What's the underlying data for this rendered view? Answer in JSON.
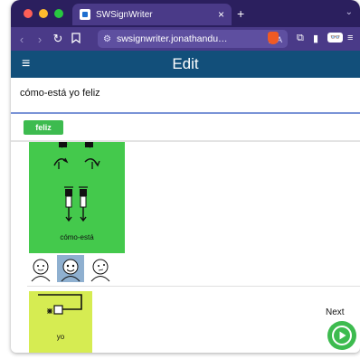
{
  "browser": {
    "traffic_lights": [
      "#fe5f57",
      "#febc2e",
      "#28c840"
    ],
    "tab_title": "SWSignWriter",
    "tab_close": "×",
    "new_tab": "+",
    "tab_menu": "⌄",
    "url": "swsignwriter.jonathandu…",
    "icons": [
      "back-arrow-icon",
      "forward-arrow-icon",
      "reload-icon",
      "bookmark-icon",
      "site-settings-icon",
      "translate-icon",
      "brave-shield-icon",
      "extensions-icon",
      "sidebar-icon",
      "private-glasses-icon",
      "menu-icon"
    ]
  },
  "app": {
    "title": "Edit",
    "header_color": "#124f7a",
    "sign_text": "cómo-está yo feliz",
    "chip": "feliz",
    "chip_color": "#3dbb4f"
  },
  "signs": [
    {
      "label": "cómo-está",
      "color": "#44c94c"
    },
    {
      "label": "yo",
      "color": "#d6ec52"
    }
  ],
  "faces": [
    "face-neutral-icon",
    "face-selected-icon",
    "face-tilted-icon"
  ],
  "next": {
    "label": "Next"
  }
}
